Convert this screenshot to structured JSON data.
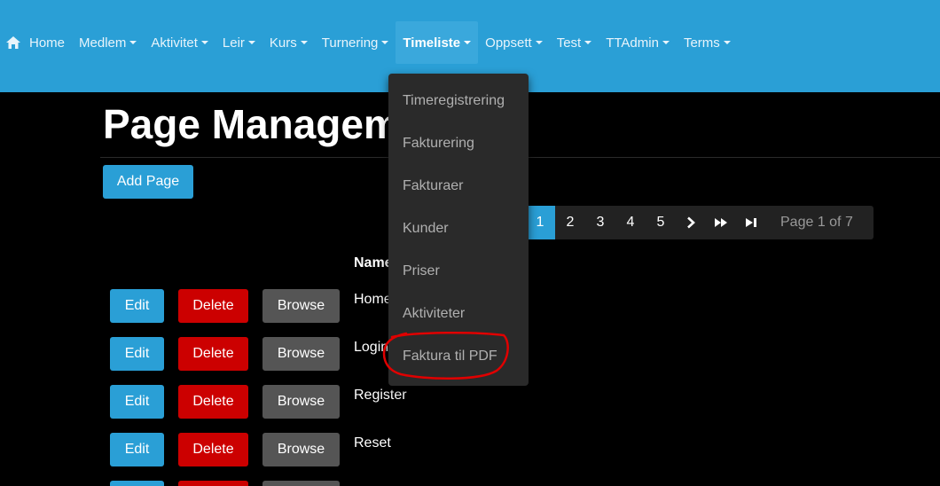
{
  "navbar": {
    "items": [
      {
        "label": "Home",
        "icon": "home-icon"
      },
      {
        "label": "Medlem"
      },
      {
        "label": "Aktivitet"
      },
      {
        "label": "Leir"
      },
      {
        "label": "Kurs"
      },
      {
        "label": "Turnering"
      },
      {
        "label": "Timeliste",
        "active": true
      },
      {
        "label": "Oppsett"
      },
      {
        "label": "Test"
      },
      {
        "label": "TTAdmin"
      },
      {
        "label": "Terms"
      }
    ]
  },
  "header": {
    "title": "Page Management"
  },
  "toolbar": {
    "add_page_label": "Add Page"
  },
  "pagination": {
    "pages": [
      "1",
      "2",
      "3",
      "4",
      "5"
    ],
    "current": "1",
    "info": "Page 1 of 7"
  },
  "table": {
    "name_header": "Name",
    "row_buttons": {
      "edit": "Edit",
      "delete": "Delete",
      "browse": "Browse"
    },
    "rows": [
      {
        "name": "Home"
      },
      {
        "name": "Login"
      },
      {
        "name": "Register"
      },
      {
        "name": "Reset"
      },
      {
        "name": ""
      }
    ]
  },
  "dropdown": {
    "items": [
      "Timeregistrering",
      "Fakturering",
      "Fakturaer",
      "Kunder",
      "Priser",
      "Aktiviteter",
      "Faktura til PDF"
    ]
  },
  "colors": {
    "accent": "#2a9fd6",
    "danger": "#cc0000",
    "secondary": "#555555",
    "annotation": "#e00000"
  }
}
